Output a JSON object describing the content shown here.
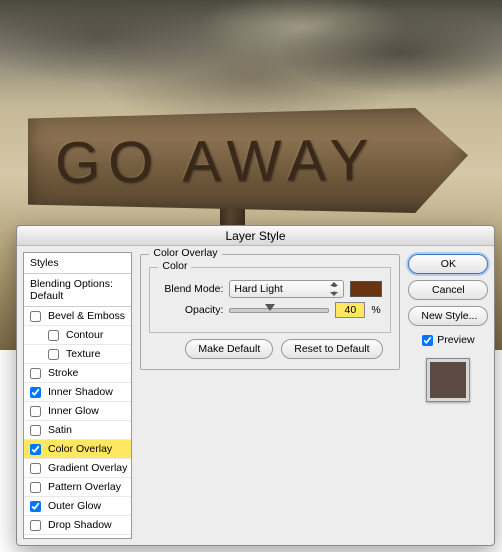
{
  "background_sign_text": "GO AWAY",
  "dialog": {
    "title": "Layer Style",
    "left_panel": {
      "styles_label": "Styles",
      "blending_label": "Blending Options: Default",
      "items": [
        {
          "label": "Bevel & Emboss",
          "checked": false,
          "indent": false
        },
        {
          "label": "Contour",
          "checked": false,
          "indent": true
        },
        {
          "label": "Texture",
          "checked": false,
          "indent": true
        },
        {
          "label": "Stroke",
          "checked": false,
          "indent": false
        },
        {
          "label": "Inner Shadow",
          "checked": true,
          "indent": false
        },
        {
          "label": "Inner Glow",
          "checked": false,
          "indent": false
        },
        {
          "label": "Satin",
          "checked": false,
          "indent": false
        },
        {
          "label": "Color Overlay",
          "checked": true,
          "indent": false,
          "selected": true
        },
        {
          "label": "Gradient Overlay",
          "checked": false,
          "indent": false
        },
        {
          "label": "Pattern Overlay",
          "checked": false,
          "indent": false
        },
        {
          "label": "Outer Glow",
          "checked": true,
          "indent": false
        },
        {
          "label": "Drop Shadow",
          "checked": false,
          "indent": false
        }
      ]
    },
    "center": {
      "group_title": "Color Overlay",
      "color_group_title": "Color",
      "blend_mode_label": "Blend Mode:",
      "blend_mode_value": "Hard Light",
      "color_swatch": "#6b3410",
      "opacity_label": "Opacity:",
      "opacity_value": "40",
      "opacity_unit": "%",
      "opacity_percent": 40,
      "make_default": "Make Default",
      "reset_default": "Reset to Default"
    },
    "right": {
      "ok": "OK",
      "cancel": "Cancel",
      "new_style": "New Style...",
      "preview_label": "Preview",
      "preview_checked": true,
      "preview_color": "#5a4a42"
    }
  }
}
